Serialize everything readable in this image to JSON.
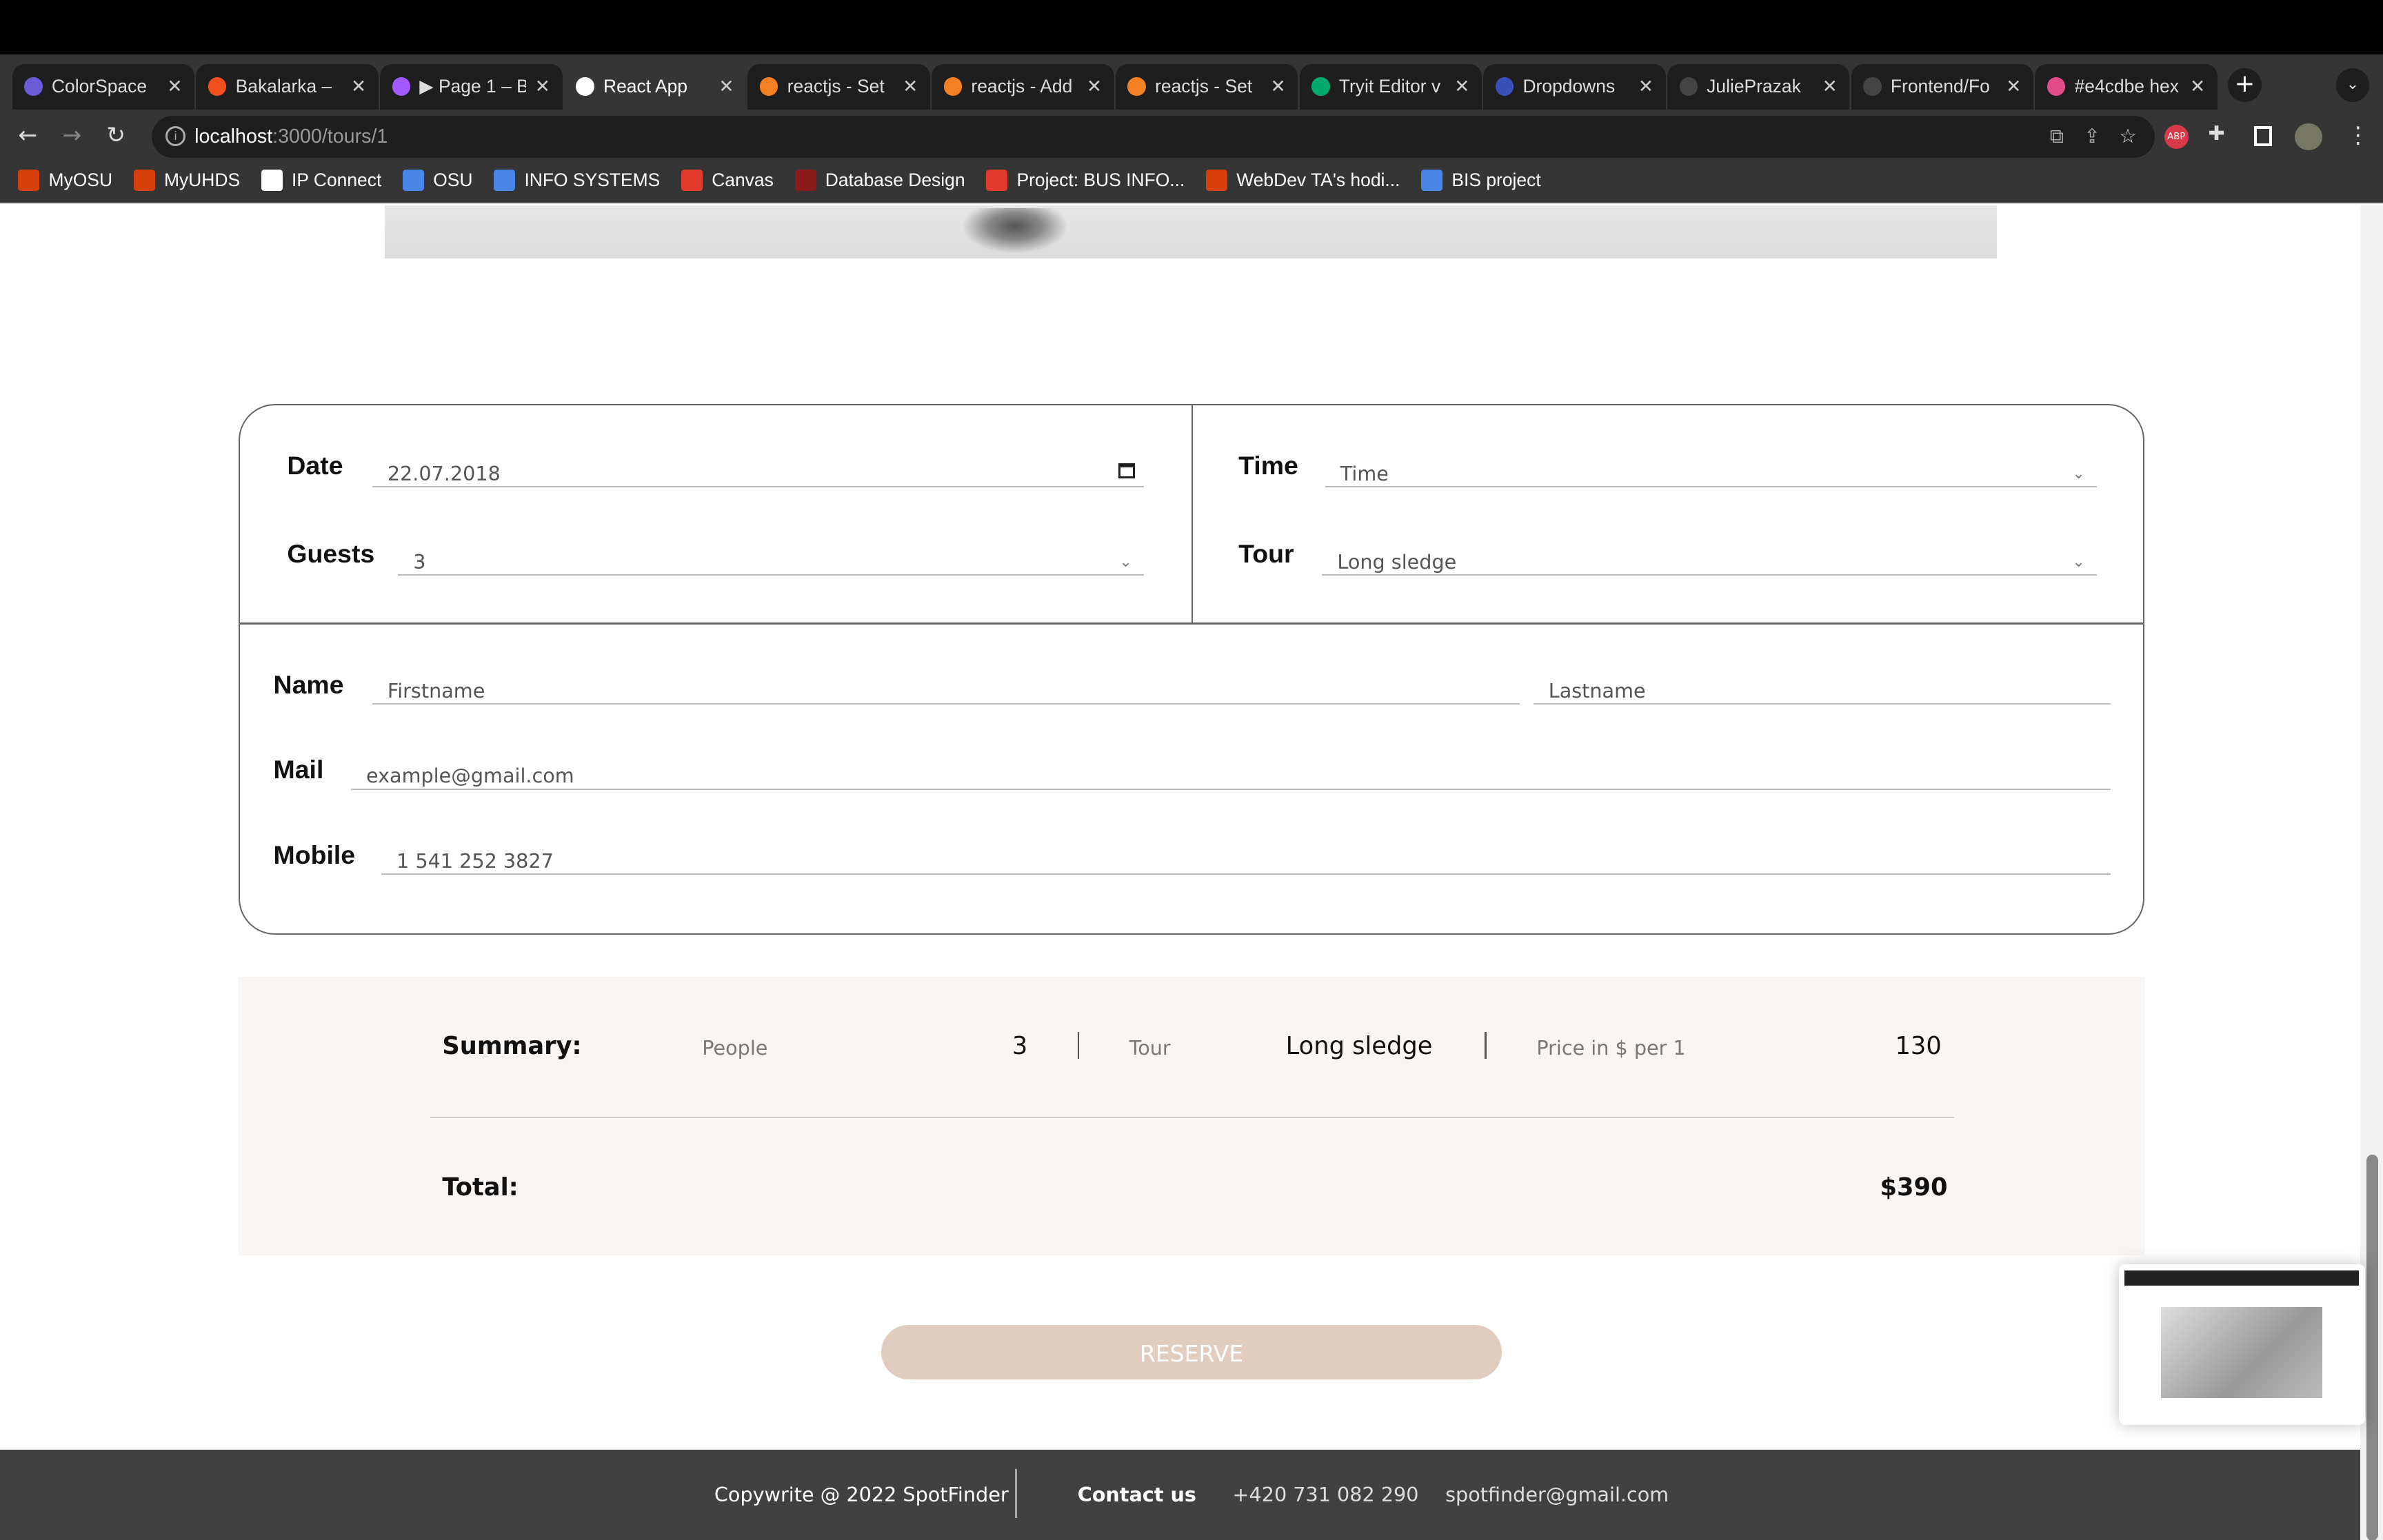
{
  "browser": {
    "tabs": [
      {
        "label": "ColorSpace",
        "color": "#6b5bd6"
      },
      {
        "label": "Bakalarka –",
        "color": "#f24e1e"
      },
      {
        "label": "▶ Page 1 – B",
        "color": "#a259ff"
      },
      {
        "label": "React App",
        "color": "#ffffff",
        "active": true
      },
      {
        "label": "reactjs - Set",
        "color": "#f48024"
      },
      {
        "label": "reactjs - Add",
        "color": "#f48024"
      },
      {
        "label": "reactjs - Set",
        "color": "#f48024"
      },
      {
        "label": "Tryit Editor v",
        "color": "#04aa6d"
      },
      {
        "label": "Dropdowns",
        "color": "#3b4fb8"
      },
      {
        "label": "JuliePrazak",
        "color": "#444444"
      },
      {
        "label": "Frontend/Fo",
        "color": "#444444"
      },
      {
        "label": "#e4cdbe hex",
        "color": "#e34c8b"
      }
    ],
    "url_host": "localhost",
    "url_path": ":3000/tours/1",
    "bookmarks": [
      {
        "label": "MyOSU",
        "color": "#d73f09"
      },
      {
        "label": "MyUHDS",
        "color": "#d73f09"
      },
      {
        "label": "IP Connect",
        "color": "#ffffff"
      },
      {
        "label": "OSU",
        "color": "#4a86e8"
      },
      {
        "label": "INFO SYSTEMS",
        "color": "#4a86e8"
      },
      {
        "label": "Canvas",
        "color": "#e23b2e"
      },
      {
        "label": "Database Design",
        "color": "#8b1a1a"
      },
      {
        "label": "Project: BUS INFO...",
        "color": "#e23b2e"
      },
      {
        "label": "WebDev TA's hodi...",
        "color": "#d73f09"
      },
      {
        "label": "BIS project",
        "color": "#4a86e8"
      }
    ]
  },
  "form": {
    "date_label": "Date",
    "date_value": "22.07.2018",
    "time_label": "Time",
    "time_value": "Time",
    "guests_label": "Guests",
    "guests_value": "3",
    "tour_label": "Tour",
    "tour_value": "Long sledge",
    "name_label": "Name",
    "firstname_placeholder": "Firstname",
    "lastname_placeholder": "Lastname",
    "mail_label": "Mail",
    "mail_value": "example@gmail.com",
    "mobile_label": "Mobile",
    "mobile_value": "1 541 252 3827"
  },
  "summary": {
    "title": "Summary:",
    "people_label": "People",
    "people_value": "3",
    "tour_label": "Tour",
    "tour_value": "Long sledge",
    "price_label": "Price in $ per 1",
    "price_value": "130",
    "total_label": "Total:",
    "total_value": "$390"
  },
  "reserve_label": "RESERVE",
  "footer": {
    "copyright": "Copywrite @ 2022 SpotFinder",
    "contact": "Contact us",
    "phone": "+420 731 082 290",
    "email": "spotfinder@gmail.com"
  }
}
